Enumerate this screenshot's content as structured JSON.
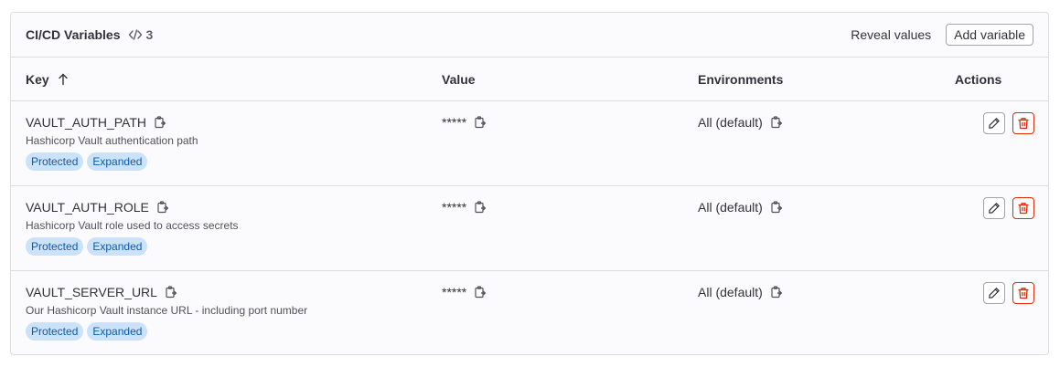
{
  "header": {
    "title": "CI/CD Variables",
    "count": "3",
    "reveal_label": "Reveal values",
    "add_label": "Add variable"
  },
  "columns": {
    "key": "Key",
    "value": "Value",
    "environments": "Environments",
    "actions": "Actions"
  },
  "rows": [
    {
      "key": "VAULT_AUTH_PATH",
      "description": "Hashicorp Vault authentication path",
      "badges": [
        "Protected",
        "Expanded"
      ],
      "value": "*****",
      "environment": "All (default)"
    },
    {
      "key": "VAULT_AUTH_ROLE",
      "description": "Hashicorp Vault role used to access secrets",
      "badges": [
        "Protected",
        "Expanded"
      ],
      "value": "*****",
      "environment": "All (default)"
    },
    {
      "key": "VAULT_SERVER_URL",
      "description": "Our Hashicorp Vault instance URL - including port number",
      "badges": [
        "Protected",
        "Expanded"
      ],
      "value": "*****",
      "environment": "All (default)"
    }
  ],
  "colors": {
    "badge_bg": "#cbe2f9",
    "badge_text": "#0b5cad",
    "danger": "#dd2b0e"
  },
  "icons": {
    "count": "code-icon",
    "sort": "arrow-up-icon",
    "copy": "copy-to-clipboard-icon",
    "edit": "pencil-icon",
    "delete": "trash-icon"
  }
}
